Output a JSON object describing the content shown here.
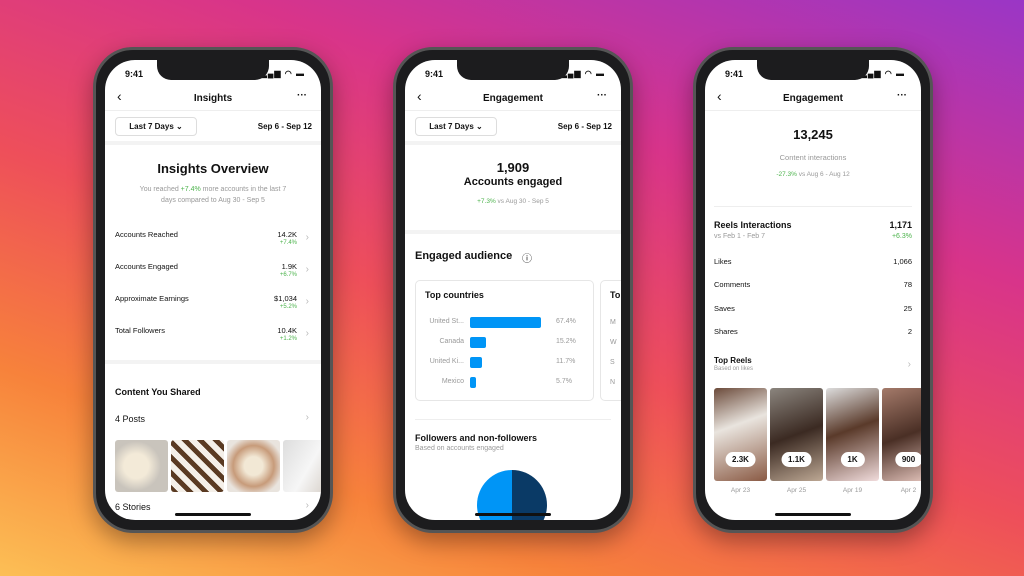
{
  "status": {
    "time": "9:41",
    "icons": "signal wifi battery"
  },
  "common": {
    "back": "‹",
    "more": "···",
    "date_filter": "Last 7 Days",
    "chevron": "⌄",
    "range": "Sep 6 - Sep 12"
  },
  "phone1": {
    "title": "Insights",
    "overview_title": "Insights Overview",
    "summary": {
      "pre": "You reached ",
      "pct": "+7.4%",
      "post": " more accounts in the last 7",
      "line2": "days compared to Aug 30 - Sep 5"
    },
    "metrics": [
      {
        "label": "Accounts Reached",
        "value": "14.2K",
        "change": "+7.4%"
      },
      {
        "label": "Accounts Engaged",
        "value": "1.9K",
        "change": "+6.7%"
      },
      {
        "label": "Approximate Earnings",
        "value": "$1,034",
        "change": "+5.2%"
      },
      {
        "label": "Total Followers",
        "value": "10.4K",
        "change": "+1.2%"
      }
    ],
    "content_title": "Content You Shared",
    "posts": "4 Posts",
    "stories": "6 Stories"
  },
  "phone2": {
    "title": "Engagement",
    "count": "1,909",
    "count_label": "Accounts engaged",
    "change": "+7.3%",
    "change_vs": " vs Aug 30 - Sep 5",
    "audience_title": "Engaged audience",
    "info_icon": "ⓘ",
    "top_countries": {
      "title": "Top countries",
      "rows": [
        {
          "label": "United St...",
          "pct": "67.4%",
          "value": 67.4
        },
        {
          "label": "Canada",
          "pct": "15.2%",
          "value": 15.2
        },
        {
          "label": "United Ki...",
          "pct": "11.7%",
          "value": 11.7
        },
        {
          "label": "Mexico",
          "pct": "5.7%",
          "value": 5.7
        }
      ]
    },
    "second_card": {
      "title": "To",
      "rows": [
        "M",
        "W",
        "S",
        "N"
      ]
    },
    "followers_title": "Followers and non-followers",
    "followers_sub": "Based on accounts engaged",
    "colors": {
      "followers": "#0095f6",
      "non_followers": "#0a3a66"
    }
  },
  "phone3": {
    "title": "Engagement",
    "count": "13,245",
    "count_label": "Content interactions",
    "change": "-27.3%",
    "change_vs": " vs Aug 6 - Aug 12",
    "reels_title": "Reels Interactions",
    "reels_vs": "vs Feb 1 - Feb 7",
    "reels_value": "1,171",
    "reels_change": "+6.3%",
    "rows": [
      {
        "label": "Likes",
        "value": "1,066"
      },
      {
        "label": "Comments",
        "value": "78"
      },
      {
        "label": "Saves",
        "value": "25"
      },
      {
        "label": "Shares",
        "value": "2"
      }
    ],
    "top_reels": "Top Reels",
    "top_reels_sub": "Based on likes",
    "reels": [
      {
        "count": "2.3K",
        "date": "Apr 23"
      },
      {
        "count": "1.1K",
        "date": "Apr 25"
      },
      {
        "count": "1K",
        "date": "Apr 19"
      },
      {
        "count": "900",
        "date": "Apr 2"
      }
    ]
  }
}
